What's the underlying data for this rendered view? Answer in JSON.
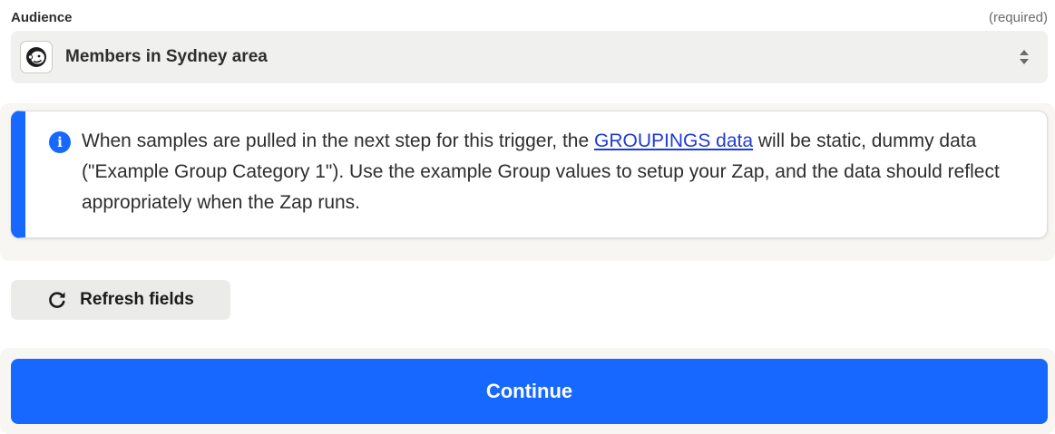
{
  "audience_field": {
    "label": "Audience",
    "required_text": "(required)",
    "selected_value": "Members in Sydney area",
    "app_icon": "mailchimp-icon",
    "arrows_icon": "sort-arrows-icon"
  },
  "info_banner": {
    "icon": "info-icon",
    "text_before_link": "When samples are pulled in the next step for this trigger, the ",
    "link_text": "GROUPINGS data",
    "text_after_link": " will be static, dummy data (\"Example Group Category 1\"). Use the example Group values to setup your Zap, and the data should reflect appropriately when the Zap runs."
  },
  "refresh_button": {
    "label": "Refresh fields",
    "icon": "refresh-icon"
  },
  "continue_button": {
    "label": "Continue"
  },
  "colors": {
    "accent": "#1768ff",
    "link": "#1f3bd6",
    "select_bg": "#f0f0ee",
    "secondary_button_bg": "#ebebe9"
  }
}
